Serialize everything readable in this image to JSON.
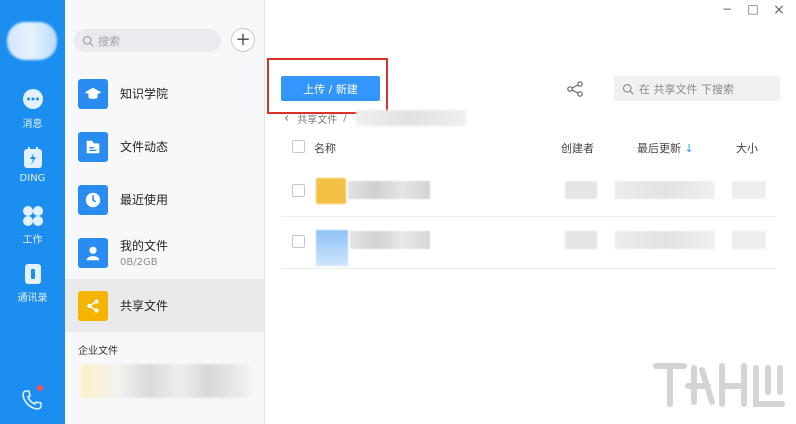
{
  "rail": {
    "items": [
      {
        "label": "消息",
        "icon": "message-icon"
      },
      {
        "label": "DING",
        "icon": "ding-icon"
      },
      {
        "label": "工作",
        "icon": "work-icon"
      },
      {
        "label": "通讯录",
        "icon": "contacts-icon"
      }
    ],
    "bottom_icon": "phone-icon"
  },
  "sidebar": {
    "search_placeholder": "搜索",
    "add_label": "+",
    "items": [
      {
        "label": "知识学院",
        "sub": "",
        "icon": "graduation-cap-icon",
        "color": "#2a8cf0"
      },
      {
        "label": "文件动态",
        "sub": "",
        "icon": "folder-icon",
        "color": "#2a8cf0"
      },
      {
        "label": "最近使用",
        "sub": "",
        "icon": "clock-icon",
        "color": "#2a8cf0"
      },
      {
        "label": "我的文件",
        "sub": "0B/2GB",
        "icon": "user-icon",
        "color": "#2a8cf0"
      },
      {
        "label": "共享文件",
        "sub": "",
        "icon": "share-icon",
        "color": "#f5b400",
        "active": true
      }
    ],
    "section_title": "企业文件"
  },
  "window": {
    "minimize": "−",
    "maximize": "□",
    "close": "×"
  },
  "toolbar": {
    "upload_label": "上传 / 新建",
    "search_placeholder": "在 共享文件 下搜索"
  },
  "breadcrumb": {
    "back": "‹",
    "item": "共享文件",
    "sep": "/"
  },
  "table": {
    "columns": {
      "name": "名称",
      "creator": "创建者",
      "updated": "最后更新",
      "updated_sort": "↓",
      "size": "大小"
    }
  },
  "colors": {
    "rail": "#1b8ef0",
    "accent": "#3296fa",
    "highlight_box": "#d9332a"
  }
}
